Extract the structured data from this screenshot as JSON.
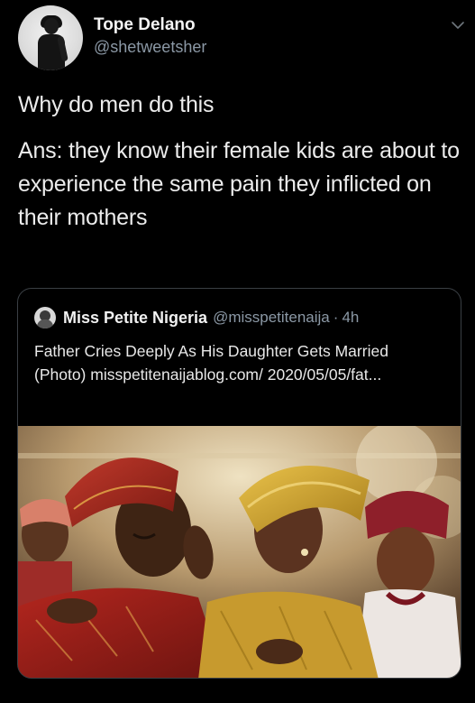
{
  "tweet": {
    "author": {
      "display_name": "Tope Delano",
      "handle": "@shetweetsher"
    },
    "lines": [
      "Why do men do this",
      "Ans: they know their female kids are about to experience the same pain they inflicted on their mothers"
    ],
    "menu_icon": "chevron-down-icon"
  },
  "quoted_tweet": {
    "author": {
      "display_name": "Miss Petite Nigeria",
      "handle": "@misspetitenaija"
    },
    "separator": "·",
    "time": "4h",
    "text": "Father Cries Deeply As His Daughter Gets Married (Photo) misspetitenaijablog.com/ 2020/05/05/fat...",
    "photo_icon": "wedding-photo"
  },
  "colors": {
    "background": "#000000",
    "text_primary": "#e7e9ea",
    "text_secondary": "#8b98a5",
    "border": "#3a3f44"
  }
}
